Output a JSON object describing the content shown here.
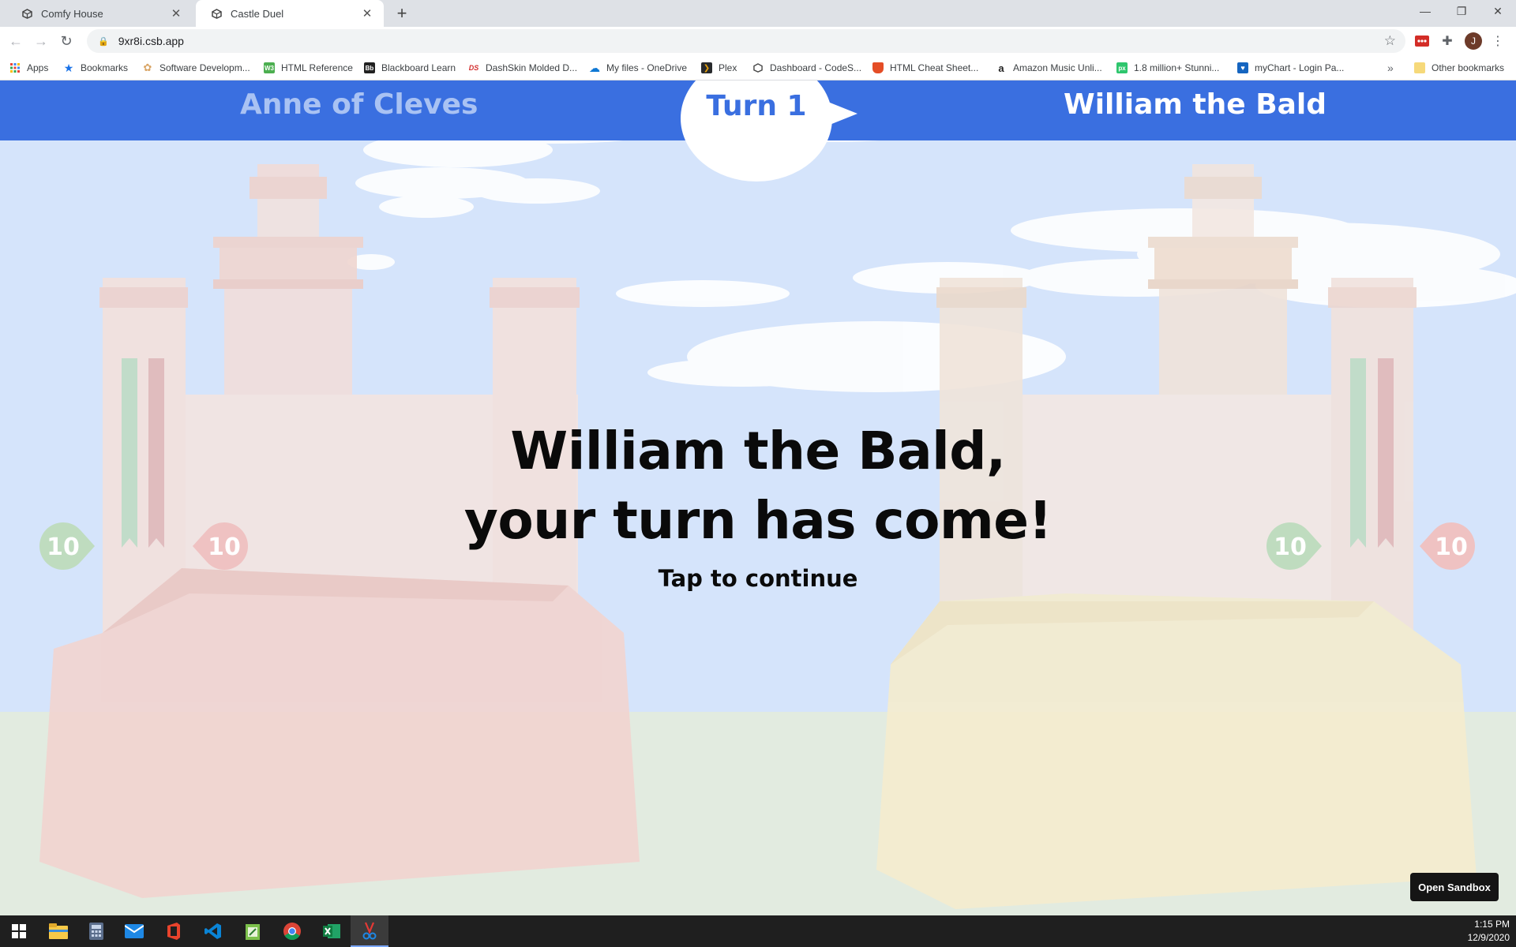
{
  "browser": {
    "tabs": [
      {
        "title": "Comfy House",
        "icon": "codesandbox-icon"
      },
      {
        "title": "Castle Duel",
        "icon": "codesandbox-icon"
      }
    ],
    "url": "9xr8i.csb.app",
    "profile_initial": "J",
    "bookmarks": [
      {
        "label": "Apps",
        "icon": "apps-grid-icon",
        "color": "#ea4335"
      },
      {
        "label": "Bookmarks",
        "icon": "star-icon",
        "color": "#1a73e8"
      },
      {
        "label": "Software Developm...",
        "icon": "flower-icon",
        "color": "#d9a566"
      },
      {
        "label": "HTML Reference",
        "icon": "w3-icon",
        "color": "#4caf50"
      },
      {
        "label": "Blackboard Learn",
        "icon": "blackboard-icon",
        "color": "#222222"
      },
      {
        "label": "DashSkin Molded D...",
        "icon": "ds-icon",
        "color": "#d32f2f"
      },
      {
        "label": "My files - OneDrive",
        "icon": "cloud-icon",
        "color": "#0f78d4"
      },
      {
        "label": "Plex",
        "icon": "plex-icon",
        "color": "#e5a00d"
      },
      {
        "label": "Dashboard - CodeS...",
        "icon": "codesandbox-icon",
        "color": "#444444"
      },
      {
        "label": "HTML Cheat Sheet...",
        "icon": "shield-icon",
        "color": "#e44d26"
      },
      {
        "label": "Amazon Music Unli...",
        "icon": "amazon-icon",
        "color": "#222222"
      },
      {
        "label": "1.8 million+ Stunni...",
        "icon": "pixabay-icon",
        "color": "#2ec66d"
      },
      {
        "label": "myChart - Login Pa...",
        "icon": "mychart-icon",
        "color": "#1565c0"
      }
    ],
    "overflow_label": "»",
    "other_bookmarks": "Other bookmarks"
  },
  "game": {
    "player_left": "Anne of Cleves",
    "player_right": "William the Bald",
    "turn_label": "Turn 1",
    "message_line1": "William the Bald,",
    "message_line2": "your turn has come!",
    "message_sub": "Tap to continue",
    "left_health": "10",
    "left_defense": "10",
    "right_health": "10",
    "right_defense": "10",
    "sandbox_button": "Open Sandbox",
    "colors": {
      "header": "#3a6fe0",
      "sky": "#d5e4fb",
      "ground": "#e2ebe0",
      "left_castle": "#f3d3cf",
      "right_castle": "#f4ead0",
      "health_badge": "#bfdcbf",
      "defense_badge": "#efc2c2"
    }
  },
  "taskbar": {
    "time": "1:15 PM",
    "date": "12/9/2020",
    "apps": [
      "windows-start-icon",
      "file-explorer-icon",
      "calculator-icon",
      "mail-icon",
      "office-icon",
      "vscode-icon",
      "notepad-icon",
      "chrome-icon",
      "excel-icon",
      "snipping-tool-icon"
    ]
  }
}
